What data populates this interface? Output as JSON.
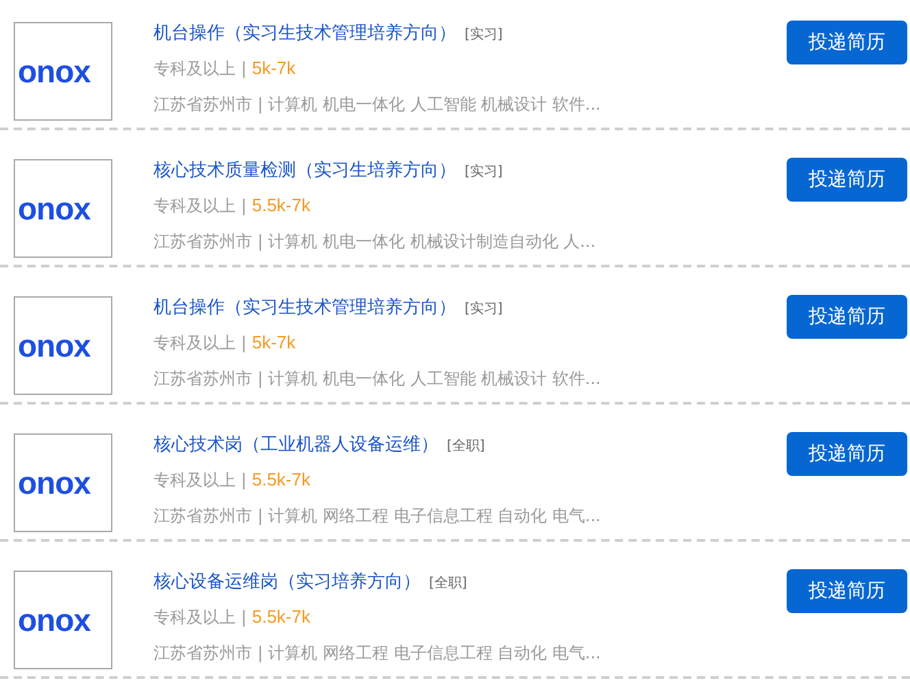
{
  "jobs": [
    {
      "logo_text": "onox",
      "title": "机台操作（实习生技术管理培养方向）",
      "type_tag": "[实习]",
      "education": "专科及以上 |",
      "salary": "5k-7k",
      "details": "江苏省苏州市 | 计算机 机电一体化 人工智能 机械设计 软件...",
      "apply_button": "投递简历"
    },
    {
      "logo_text": "onox",
      "title": "核心技术质量检测（实习生培养方向）",
      "type_tag": "[实习]",
      "education": "专科及以上 |",
      "salary": "5.5k-7k",
      "details": "江苏省苏州市 | 计算机 机电一体化 机械设计制造自动化 人...",
      "apply_button": "投递简历"
    },
    {
      "logo_text": "onox",
      "title": "机台操作（实习生技术管理培养方向）",
      "type_tag": "[实习]",
      "education": "专科及以上 |",
      "salary": "5k-7k",
      "details": "江苏省苏州市 | 计算机 机电一体化 人工智能 机械设计 软件...",
      "apply_button": "投递简历"
    },
    {
      "logo_text": "onox",
      "title": "核心技术岗（工业机器人设备运维）",
      "type_tag": "[全职]",
      "education": "专科及以上 |",
      "salary": "5.5k-7k",
      "details": "江苏省苏州市 | 计算机 网络工程 电子信息工程 自动化 电气...",
      "apply_button": "投递简历"
    },
    {
      "logo_text": "onox",
      "title": "核心设备运维岗（实习培养方向）",
      "type_tag": "[全职]",
      "education": "专科及以上 |",
      "salary": "5.5k-7k",
      "details": "江苏省苏州市 | 计算机 网络工程 电子信息工程 自动化 电气...",
      "apply_button": "投递简历"
    }
  ]
}
